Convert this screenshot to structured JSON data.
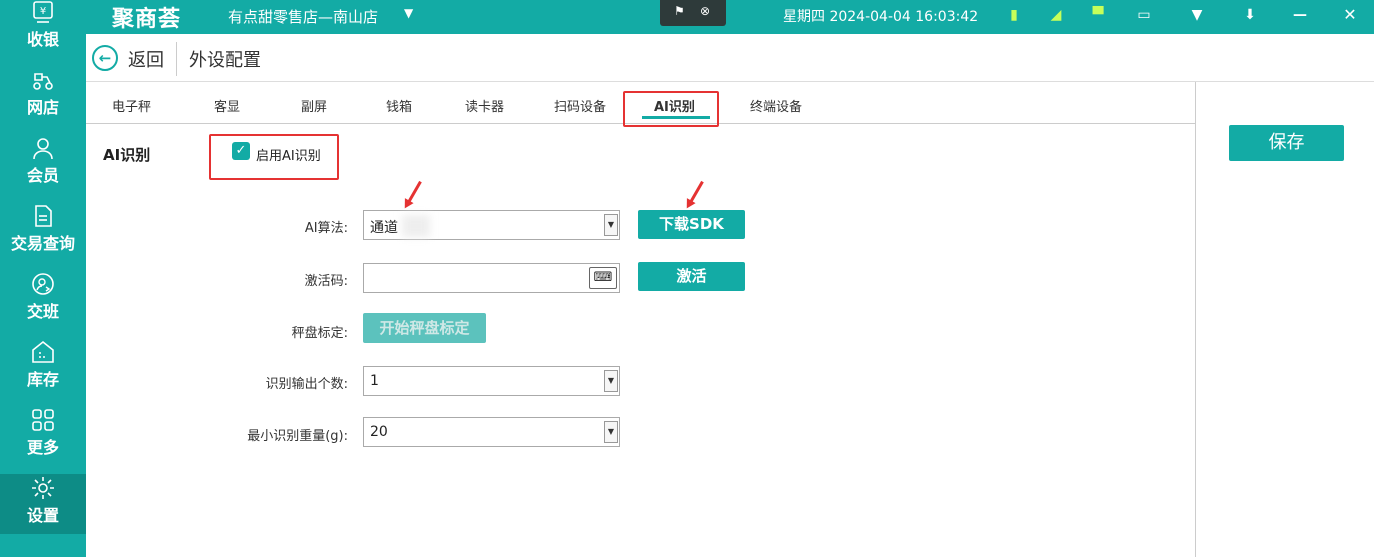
{
  "titlebar": {
    "logo": "聚商荟",
    "store": "有点甜零售店—南山店",
    "datetime": "星期四 2024-04-04 16:03:42"
  },
  "sidebar": {
    "items": [
      {
        "label": "收银",
        "icon": "cashier-icon"
      },
      {
        "label": "网店",
        "icon": "delivery-icon"
      },
      {
        "label": "会员",
        "icon": "member-icon"
      },
      {
        "label": "交易查询",
        "icon": "document-icon"
      },
      {
        "label": "交班",
        "icon": "shift-icon"
      },
      {
        "label": "库存",
        "icon": "warehouse-icon"
      },
      {
        "label": "更多",
        "icon": "grid-icon"
      },
      {
        "label": "设置",
        "icon": "gear-icon"
      }
    ]
  },
  "header": {
    "back_label": "返回",
    "title": "外设配置"
  },
  "tabs": [
    "电子秤",
    "客显",
    "副屏",
    "钱箱",
    "读卡器",
    "扫码设备",
    "AI识别",
    "终端设备"
  ],
  "ai": {
    "section_label": "AI识别",
    "enable_label": "启用AI识别",
    "algorithm_label": "AI算法:",
    "algorithm_value": "通道",
    "download_label": "下载SDK",
    "activation_label": "激活码:",
    "activation_value": "",
    "activate_label": "激活",
    "calibrate_label": "秤盘标定:",
    "calibrate_button": "开始秤盘标定",
    "output_count_label": "识别输出个数:",
    "output_count_value": "1",
    "min_weight_label": "最小识别重量(g):",
    "min_weight_value": "20"
  },
  "save_label": "保存",
  "colors": {
    "accent": "#13aba5",
    "highlight": "#e53232"
  }
}
